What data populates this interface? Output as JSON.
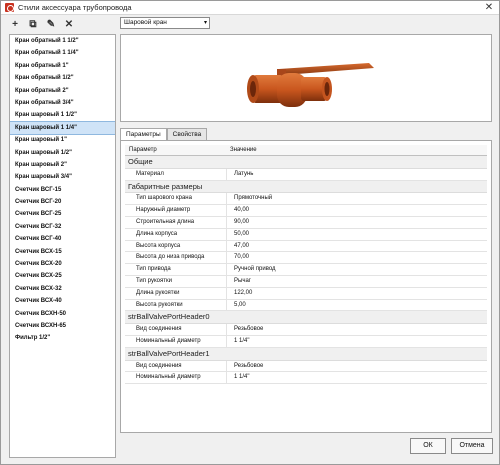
{
  "window": {
    "title": "Стили аксессуара трубопровода",
    "close_glyph": "✕"
  },
  "toolbar": {
    "add": "+",
    "copy": "⧉",
    "edit": "✎",
    "delete": "✕"
  },
  "list": {
    "items": [
      "Кран обратный 1 1/2\"",
      "Кран обратный 1 1/4\"",
      "Кран обратный 1\"",
      "Кран обратный 1/2\"",
      "Кран обратный 2\"",
      "Кран обратный 3/4\"",
      "Кран шаровый 1 1/2\"",
      "Кран шаровый 1 1/4\"",
      "Кран шаровый 1\"",
      "Кран шаровый 1/2\"",
      "Кран шаровый 2\"",
      "Кран шаровый 3/4\"",
      "Счетчик ВСГ-15",
      "Счетчик ВСГ-20",
      "Счетчик ВСГ-25",
      "Счетчик ВСГ-32",
      "Счетчик ВСГ-40",
      "Счетчик ВСХ-15",
      "Счетчик ВСХ-20",
      "Счетчик ВСХ-25",
      "Счетчик ВСХ-32",
      "Счетчик ВСХ-40",
      "Счетчик ВСХН-50",
      "Счетчик ВСХН-65",
      "Фильтр 1/2\""
    ],
    "selected_index": 7
  },
  "type_select": {
    "value": "Шаровой кран",
    "arrow": "▾"
  },
  "tabs": [
    {
      "label": "Параметры",
      "active": true
    },
    {
      "label": "Свойства",
      "active": false
    }
  ],
  "grid": {
    "header": {
      "param": "Параметр",
      "value": "Значение"
    },
    "sections": [
      {
        "title": "Общие",
        "rows": [
          {
            "k": "Материал",
            "v": "Латунь"
          }
        ]
      },
      {
        "title": "Габаритные размеры",
        "rows": [
          {
            "k": "Тип шарового крана",
            "v": "Прямоточный"
          },
          {
            "k": "Наружный диаметр",
            "v": "40,00"
          },
          {
            "k": "Строительная длина",
            "v": "90,00"
          },
          {
            "k": "Длина корпуса",
            "v": "50,00"
          },
          {
            "k": "Высота корпуса",
            "v": "47,00"
          },
          {
            "k": "Высота до низа привода",
            "v": "70,00"
          },
          {
            "k": "Тип привода",
            "v": "Ручной привод"
          },
          {
            "k": "Тип рукоятки",
            "v": "Рычаг"
          },
          {
            "k": "Длина рукоятки",
            "v": "122,00"
          },
          {
            "k": "Высота рукоятки",
            "v": "5,00"
          }
        ]
      },
      {
        "title": "strBallValvePortHeader0",
        "rows": [
          {
            "k": "Вид соединения",
            "v": "Резьбовое"
          },
          {
            "k": "Номинальный диаметр",
            "v": "1 1/4\""
          }
        ]
      },
      {
        "title": "strBallValvePortHeader1",
        "rows": [
          {
            "k": "Вид соединения",
            "v": "Резьбовое"
          },
          {
            "k": "Номинальный диаметр",
            "v": "1 1/4\""
          }
        ]
      }
    ]
  },
  "buttons": {
    "ok": "ОК",
    "cancel": "Отмена"
  },
  "colors": {
    "accent": "#cfe3f7",
    "valve_body": "#c9561e",
    "app_icon": "#c8311f"
  }
}
